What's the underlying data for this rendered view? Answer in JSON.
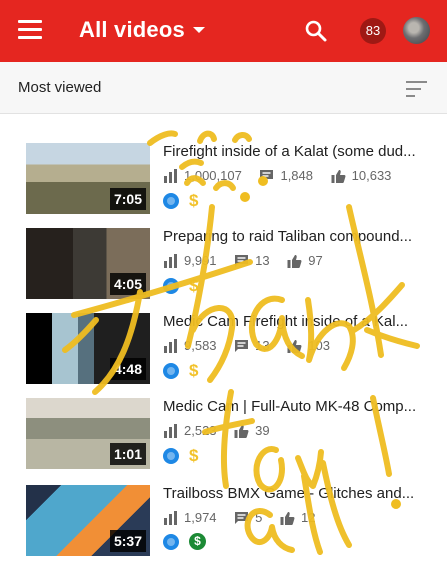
{
  "header": {
    "title": "All videos",
    "notification_count": "83",
    "accent_color": "#e52620"
  },
  "sort": {
    "label": "Most viewed"
  },
  "videos": [
    {
      "title": "Firefight inside of a Kalat (some dud...",
      "duration": "7:05",
      "views": "1,000,107",
      "comments": "1,848",
      "likes": "10,633",
      "monetized": "yellow"
    },
    {
      "title": "Preparing to raid Taliban compound...",
      "duration": "4:05",
      "views": "9,991",
      "comments": "13",
      "likes": "97",
      "monetized": "yellow"
    },
    {
      "title": "Medic Cam Firefight inside of a Kal...",
      "duration": "4:48",
      "views": "9,583",
      "comments": "13",
      "likes": "103",
      "monetized": "yellow"
    },
    {
      "title": "Medic Cam | Full-Auto MK-48 Comp...",
      "duration": "1:01",
      "views": "2,523",
      "comments": "",
      "likes": "39",
      "monetized": "yellow"
    },
    {
      "title": "Trailboss BMX Game - Glitches and...",
      "duration": "5:37",
      "views": "1,974",
      "comments": "5",
      "likes": "12",
      "monetized": "green"
    }
  ],
  "overlay": {
    "handwritten_text": "Thank you all!",
    "color": "#efbd21"
  }
}
